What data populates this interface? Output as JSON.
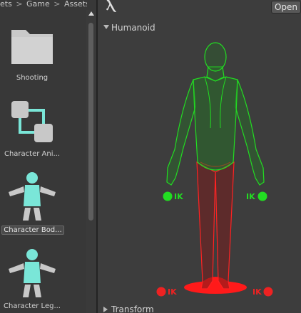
{
  "breadcrumb": {
    "items": [
      "ets",
      "Game",
      "AssetsPa"
    ],
    "separator": ">"
  },
  "assets": [
    {
      "label": "Shooting",
      "icon": "folder-icon"
    },
    {
      "label": "Character Ani...",
      "icon": "animator-controller-icon"
    },
    {
      "label": "Character Bod...",
      "icon": "avatar-mask-icon",
      "selected": true
    },
    {
      "label": "Character Leg...",
      "icon": "avatar-mask-icon"
    }
  ],
  "inspector": {
    "open_label": "Open",
    "humanoid_label": "Humanoid",
    "transform_label": "Transform",
    "ik_labels": {
      "left_hand": "IK",
      "right_hand": "IK",
      "left_foot": "IK",
      "right_foot": "IK"
    }
  },
  "colors": {
    "active": "#22dd22",
    "inactive": "#ee2222",
    "asset_accent": "#7ae6d8",
    "asset_gray": "#c8c8c8"
  }
}
